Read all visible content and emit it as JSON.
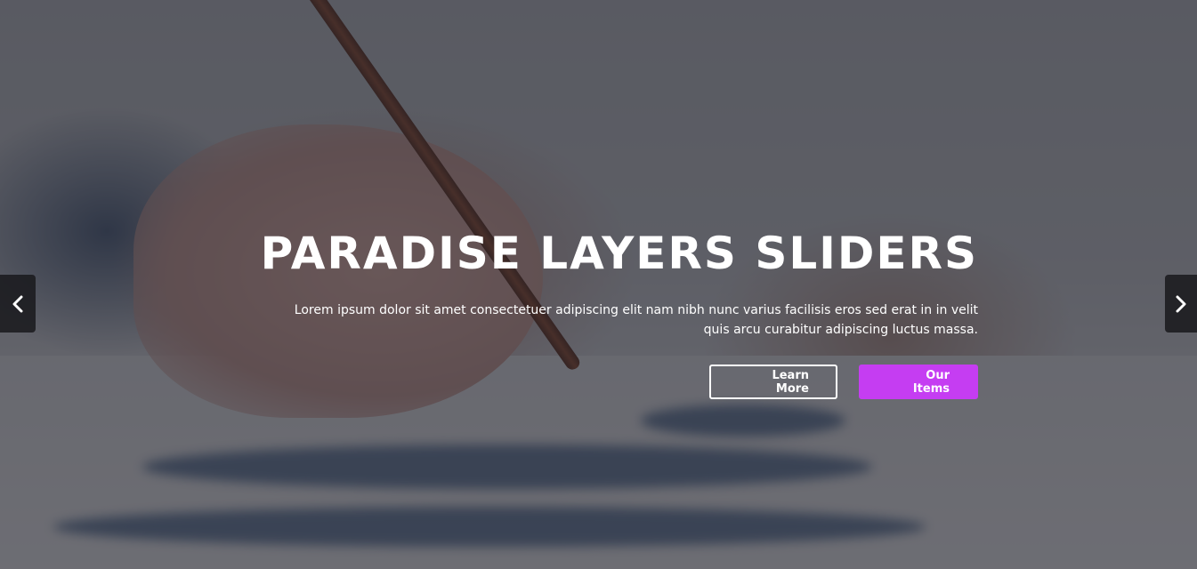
{
  "slide": {
    "title": "PARADISE LAYERS SLIDERS",
    "description_line1": "Lorem ipsum dolor sit amet consectetuer adipiscing elit nam nibh nunc varius facilisis eros sed erat in in velit",
    "description_line2": "quis arcu curabitur adipiscing luctus massa.",
    "primary_button": "Learn More",
    "secondary_button": "Our Items"
  },
  "navigation": {
    "prev_icon": "chevron-left-icon",
    "next_icon": "chevron-right-icon"
  },
  "colors": {
    "accent": "#c53df2",
    "text": "#ffffff",
    "overlay": "#1e1e26",
    "arrow_bg": "#19191c"
  }
}
